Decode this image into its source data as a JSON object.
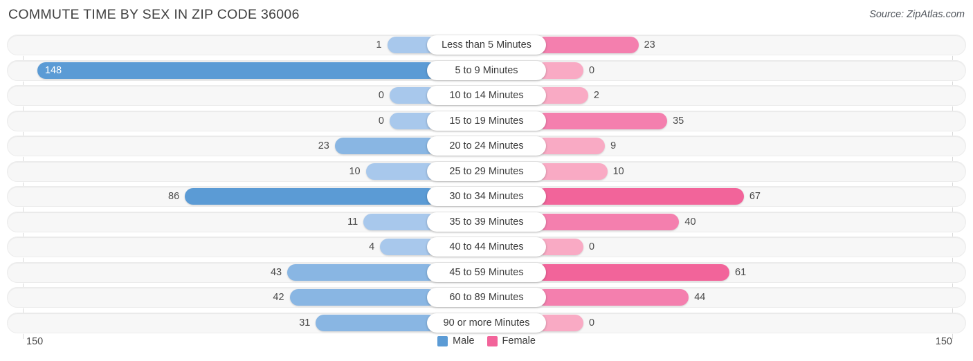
{
  "title": "COMMUTE TIME BY SEX IN ZIP CODE 36006",
  "source": "Source: ZipAtlas.com",
  "axis": {
    "left_label": "150",
    "right_label": "150",
    "max": 150
  },
  "legend": [
    {
      "label": "Male",
      "color": "#5b9bd5"
    },
    {
      "label": "Female",
      "color": "#f2649a"
    }
  ],
  "colors": {
    "male_strong": "#5b9bd5",
    "male_mid": "#89b6e3",
    "male_light": "#a8c8ec",
    "female_strong": "#f2649a",
    "female_mid": "#f47fae",
    "female_light": "#f9aac4",
    "track": "#f7f7f7",
    "axis": "#d8d8d8"
  },
  "chart_data": {
    "type": "bar",
    "title": "COMMUTE TIME BY SEX IN ZIP CODE 36006",
    "subtitle": "",
    "xlabel": "",
    "ylabel": "",
    "orientation": "horizontal-diverging",
    "grid": false,
    "legend_position": "bottom-center",
    "xlim": [
      -150,
      150
    ],
    "axis_tick_labels": [
      "150",
      "150"
    ],
    "categories": [
      "Less than 5 Minutes",
      "5 to 9 Minutes",
      "10 to 14 Minutes",
      "15 to 19 Minutes",
      "20 to 24 Minutes",
      "25 to 29 Minutes",
      "30 to 34 Minutes",
      "35 to 39 Minutes",
      "40 to 44 Minutes",
      "45 to 59 Minutes",
      "60 to 89 Minutes",
      "90 or more Minutes"
    ],
    "series": [
      {
        "name": "Male",
        "color": "#5b9bd5",
        "direction": "left",
        "values": [
          1,
          148,
          0,
          0,
          23,
          10,
          86,
          11,
          4,
          43,
          42,
          31
        ]
      },
      {
        "name": "Female",
        "color": "#f2649a",
        "direction": "right",
        "values": [
          23,
          0,
          2,
          35,
          9,
          10,
          67,
          40,
          0,
          61,
          44,
          0
        ]
      }
    ]
  },
  "rows": [
    {
      "label": "Less than 5 Minutes",
      "male": "1",
      "female": "23"
    },
    {
      "label": "5 to 9 Minutes",
      "male": "148",
      "female": "0"
    },
    {
      "label": "10 to 14 Minutes",
      "male": "0",
      "female": "2"
    },
    {
      "label": "15 to 19 Minutes",
      "male": "0",
      "female": "35"
    },
    {
      "label": "20 to 24 Minutes",
      "male": "23",
      "female": "9"
    },
    {
      "label": "25 to 29 Minutes",
      "male": "10",
      "female": "10"
    },
    {
      "label": "30 to 34 Minutes",
      "male": "86",
      "female": "67"
    },
    {
      "label": "35 to 39 Minutes",
      "male": "11",
      "female": "40"
    },
    {
      "label": "40 to 44 Minutes",
      "male": "4",
      "female": "0"
    },
    {
      "label": "45 to 59 Minutes",
      "male": "43",
      "female": "61"
    },
    {
      "label": "60 to 89 Minutes",
      "male": "42",
      "female": "44"
    },
    {
      "label": "90 or more Minutes",
      "male": "31",
      "female": "0"
    }
  ]
}
